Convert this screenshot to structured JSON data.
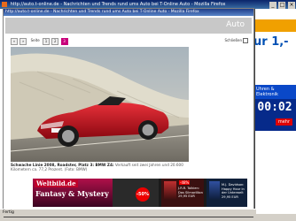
{
  "window": {
    "title": "http://auto.t-online.de - Nachrichten und Trends rund ums Auto bei T-Online Auto - Mozilla Firefox",
    "controls": [
      "_",
      "□",
      "×"
    ]
  },
  "background_page": {
    "ad_top_text": "ur 1,-",
    "ad_clock_label": "Uhren & Elektronik",
    "ad_clock_time": "00:02",
    "ad_more_button": "mehr"
  },
  "popup": {
    "title": "http://auto.t-online.de - Nachrichten und Trends rund ums Auto bei T-Online Auto - Mozilla Firefox",
    "header_label": "Auto",
    "pager": {
      "prev": "«",
      "next": "»",
      "page_label": "Seite",
      "pages": [
        "1",
        "2",
        "3"
      ],
      "active_page": "3"
    },
    "close_label": "Schließen",
    "caption_bold": "Schwache Linie 2008, Roadster, Platz 3: BMW Z4:",
    "caption_text": "Verkauft seit zwei Jahren und 20.600 Kilometern ca. 77,2 Prozent. (Foto: BMW)",
    "banner": {
      "brand": "Weltbild.de",
      "tagline": "Fantasy & Mystery",
      "sale_badge": "-50%",
      "product1_discount": "-48%",
      "product1_text": "J.R.R. Tolkien: Das Silmarillion 29,95 EUR",
      "product2_text": "M.J. Davidson: Happy Hour in der Unterwelt 29,95 EUR"
    },
    "status_url": "javascript:void(0);//?A/PR/ID=61F6D2CB/Auto?oID=9B22 NrO: 9067985"
  },
  "statusbar": {
    "text": "Fertig"
  },
  "colors": {
    "accent_magenta": "#c8007a",
    "titlebar": "#0a246a",
    "car_red": "#c4101c"
  }
}
